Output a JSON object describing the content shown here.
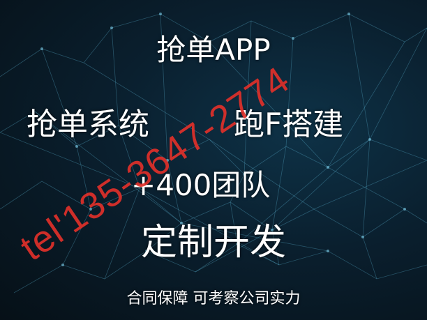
{
  "headline": "抢单APP",
  "line2_left": "抢单系统",
  "line2_right": "跑F搭建",
  "line3": "+400团队",
  "line4": "定制开发",
  "footer": "合同保障 可考察公司实力",
  "watermark": "tel'135-3647-2774",
  "colors": {
    "background": "#07131c",
    "network": "#5fb7d6",
    "text": "#ffffff",
    "watermark": "#e0302a"
  }
}
